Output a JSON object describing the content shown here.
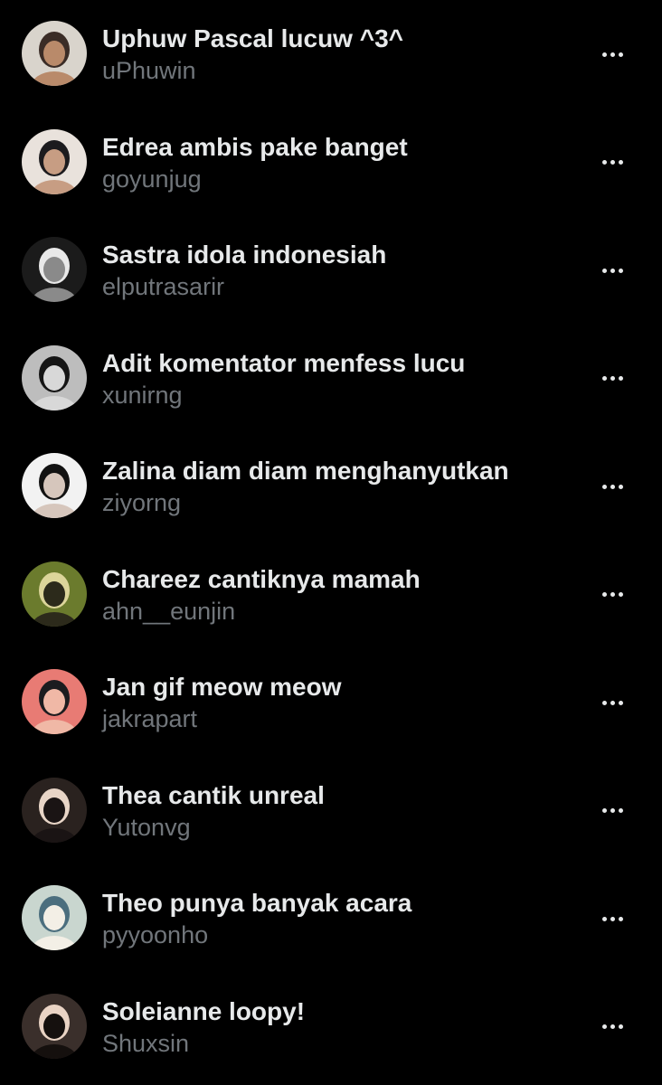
{
  "accounts": [
    {
      "display_name": "Uphuw Pascal lucuw ^3^",
      "handle": "uPhuwin",
      "avatar_bg": "#d9d4cc",
      "avatar_fg": "#3a2c26",
      "avatar_accent": "#b98a6a"
    },
    {
      "display_name": "Edrea ambis pake banget",
      "handle": "goyunjug",
      "avatar_bg": "#e9e2dc",
      "avatar_fg": "#1c1b1e",
      "avatar_accent": "#c79d83"
    },
    {
      "display_name": "Sastra idola indonesiah",
      "handle": "elputrasarir",
      "avatar_bg": "#1b1b1b",
      "avatar_fg": "#e9e9e9",
      "avatar_accent": "#8a8a8a"
    },
    {
      "display_name": "Adit komentator menfess lucu",
      "handle": "xunirng",
      "avatar_bg": "#bdbdbd",
      "avatar_fg": "#151515",
      "avatar_accent": "#d8d8d8"
    },
    {
      "display_name": "Zalina diam diam menghanyutkan",
      "handle": "ziyorng",
      "avatar_bg": "#f2f2f2",
      "avatar_fg": "#121212",
      "avatar_accent": "#d6c6bc"
    },
    {
      "display_name": "Chareez cantiknya mamah",
      "handle": "ahn__eunjin",
      "avatar_bg": "#6b7b2d",
      "avatar_fg": "#dcd59a",
      "avatar_accent": "#2c2a1b"
    },
    {
      "display_name": "Jan gif meow meow",
      "handle": "jakrapart",
      "avatar_bg": "#e87b74",
      "avatar_fg": "#1c1c1f",
      "avatar_accent": "#f0b8a6"
    },
    {
      "display_name": "Thea cantik unreal",
      "handle": "Yutonvg",
      "avatar_bg": "#2a221f",
      "avatar_fg": "#e8d5c7",
      "avatar_accent": "#1a1414"
    },
    {
      "display_name": "Theo punya banyak acara",
      "handle": "pyyoonho",
      "avatar_bg": "#c9d6cf",
      "avatar_fg": "#4b6e7e",
      "avatar_accent": "#f3efe6"
    },
    {
      "display_name": "Soleianne loopy!",
      "handle": "Shuxsin",
      "avatar_bg": "#3a2f2b",
      "avatar_fg": "#e9d3c4",
      "avatar_accent": "#15100e"
    }
  ],
  "more_icon": "more-horizontal-icon",
  "colors": {
    "background": "#000000",
    "name_text": "#e7e9ea",
    "handle_text": "#71767b"
  }
}
